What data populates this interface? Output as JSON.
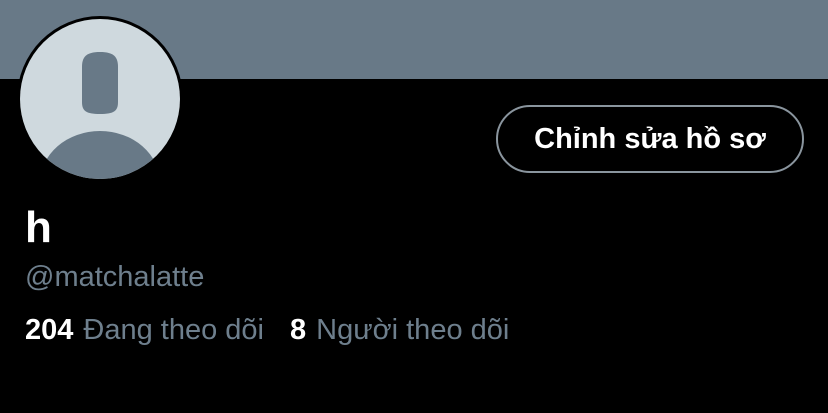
{
  "header": {
    "banner_color": "#687987"
  },
  "profile": {
    "avatar_icon": "default-avatar-icon",
    "display_name": "h",
    "handle": "@matchalatte",
    "edit_button_label": "Chỉnh sửa hồ sơ",
    "following_count": "204",
    "following_label": "Đang theo dõi",
    "followers_count": "8",
    "followers_label": "Người theo dõi"
  },
  "colors": {
    "background": "#000000",
    "text_primary": "#ffffff",
    "text_secondary": "#6e7f8d",
    "avatar_bg": "#cfd9de",
    "avatar_silhouette": "#687987",
    "button_border": "#8a959e"
  }
}
